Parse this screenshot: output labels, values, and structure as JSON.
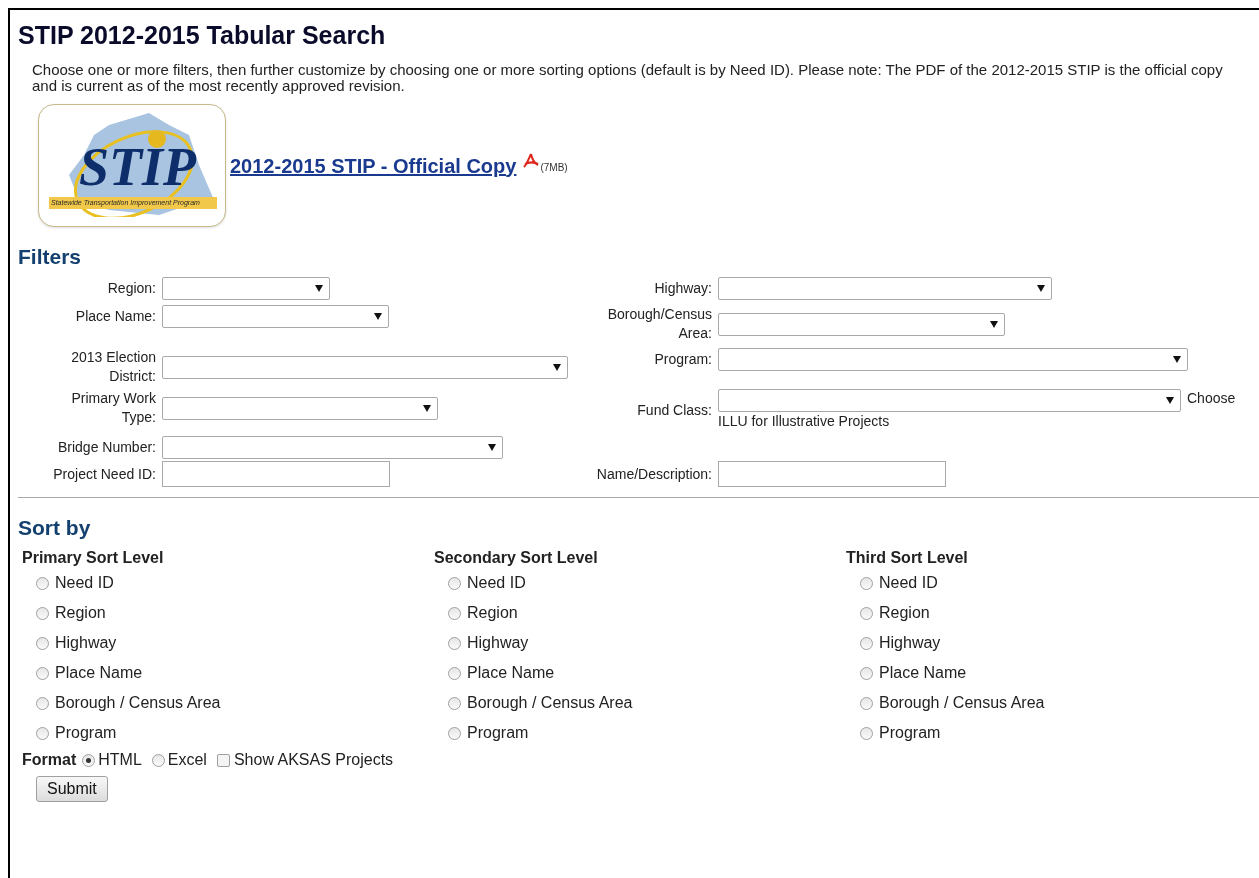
{
  "title": "STIP 2012-2015 Tabular Search",
  "intro": "Choose one or more filters, then further customize by choosing one or more sorting options (default is by Need ID). Please note: The PDF of the 2012-2015 STIP is the official copy and is current as of the most recently approved revision.",
  "logo": {
    "title": "STIP",
    "tagline": "Statewide Transportation Improvement Program"
  },
  "pdf_link": {
    "label": "2012-2015 STIP - Official Copy",
    "size": "(7MB)"
  },
  "filters": {
    "heading": "Filters",
    "rows": [
      {
        "left": {
          "label": "Region:",
          "kind": "select"
        },
        "right": {
          "label": "Highway:",
          "kind": "select"
        }
      },
      {
        "left": {
          "label": "Place Name:",
          "kind": "select"
        },
        "right": {
          "label": "Borough/Census Area:",
          "kind": "select"
        }
      },
      {
        "left": {
          "label": "2013 Election District:",
          "kind": "select"
        },
        "right": {
          "label": "Program:",
          "kind": "select"
        }
      },
      {
        "left": {
          "label": "Primary Work Type:",
          "kind": "select"
        },
        "right": {
          "label": "Fund Class:",
          "kind": "select",
          "hint": "Choose ILLU for Illustrative Projects"
        }
      },
      {
        "left": {
          "label": "Bridge Number:",
          "kind": "select"
        }
      },
      {
        "left": {
          "label": "Project Need ID:",
          "kind": "text"
        },
        "right": {
          "label": "Name/Description:",
          "kind": "text"
        }
      }
    ]
  },
  "sort": {
    "heading": "Sort by",
    "levels": [
      {
        "heading": "Primary Sort Level",
        "options": [
          {
            "label": "Need ID",
            "selected": false
          },
          {
            "label": "Region",
            "selected": false
          },
          {
            "label": "Highway",
            "selected": false
          },
          {
            "label": "Place Name",
            "selected": false
          },
          {
            "label": "Borough / Census Area",
            "selected": false
          },
          {
            "label": "Program",
            "selected": false
          }
        ]
      },
      {
        "heading": "Secondary Sort Level",
        "options": [
          {
            "label": "Need ID",
            "selected": false
          },
          {
            "label": "Region",
            "selected": false
          },
          {
            "label": "Highway",
            "selected": false
          },
          {
            "label": "Place Name",
            "selected": false
          },
          {
            "label": "Borough / Census Area",
            "selected": false
          },
          {
            "label": "Program",
            "selected": false
          }
        ]
      },
      {
        "heading": "Third Sort Level",
        "options": [
          {
            "label": "Need ID",
            "selected": false
          },
          {
            "label": "Region",
            "selected": false
          },
          {
            "label": "Highway",
            "selected": false
          },
          {
            "label": "Place Name",
            "selected": false
          },
          {
            "label": "Borough / Census Area",
            "selected": false
          },
          {
            "label": "Program",
            "selected": false
          }
        ]
      }
    ]
  },
  "format": {
    "label": "Format",
    "options": [
      {
        "label": "HTML",
        "selected": true
      },
      {
        "label": "Excel",
        "selected": false
      }
    ],
    "show_aksas": {
      "label": "Show AKSAS Projects",
      "checked": false
    }
  },
  "submit": "Submit"
}
